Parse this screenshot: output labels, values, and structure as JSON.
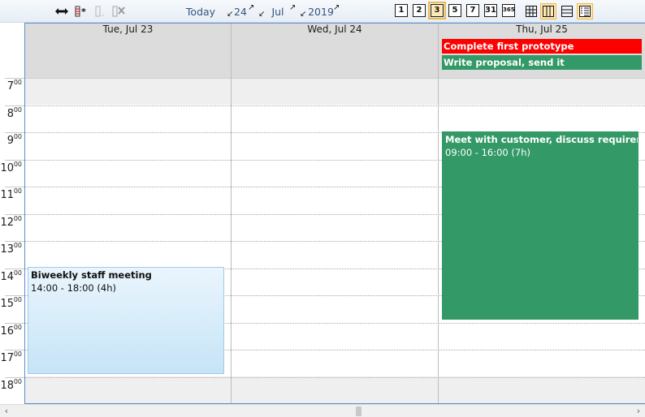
{
  "toolbar": {
    "nav": {
      "today_label": "Today",
      "day_label": "24",
      "month_label": "Jul",
      "year_label": "2019"
    },
    "view_buttons": [
      {
        "label": "1",
        "name": "day-view",
        "active": false
      },
      {
        "label": "2",
        "name": "two-day-view",
        "active": false
      },
      {
        "label": "3",
        "name": "three-day-view",
        "active": true
      },
      {
        "label": "5",
        "name": "work-week-view",
        "active": false
      },
      {
        "label": "7",
        "name": "week-view",
        "active": false
      },
      {
        "label": "31",
        "name": "month-view",
        "active": false
      },
      {
        "label": "365",
        "name": "year-view",
        "active": false
      }
    ],
    "layout_buttons": [
      {
        "name": "grid-layout",
        "active": false
      },
      {
        "name": "columns-layout",
        "active": true
      },
      {
        "name": "rows-layout",
        "active": false
      },
      {
        "name": "list-layout",
        "active": true
      }
    ]
  },
  "calendar": {
    "days": [
      {
        "label": "Tue, Jul 23"
      },
      {
        "label": "Wed, Jul 24"
      },
      {
        "label": "Thu, Jul 25"
      }
    ],
    "hours": [
      "7",
      "8",
      "9",
      "10",
      "11",
      "12",
      "13",
      "14",
      "15",
      "16",
      "17",
      "18"
    ],
    "minute_suffix": "00",
    "allday_events": [
      {
        "title": "Complete first prototype",
        "color": "#ff0000"
      },
      {
        "title": "Write proposal, send it",
        "color": "#339966"
      }
    ],
    "events": [
      {
        "title": "Biweekly staff meeting",
        "time": "14:00 - 18:00 (4h)"
      },
      {
        "title": "Meet with customer, discuss requirements",
        "time": "09:00 - 16:00 (7h)",
        "color": "#339966"
      }
    ]
  },
  "colors": {
    "accent": "#5a8fcb",
    "shade": "#efefef",
    "allday_background": "#dcdcdc",
    "event_blue_top": "#eaf5fd",
    "event_blue_bottom": "#c6e4f7"
  }
}
